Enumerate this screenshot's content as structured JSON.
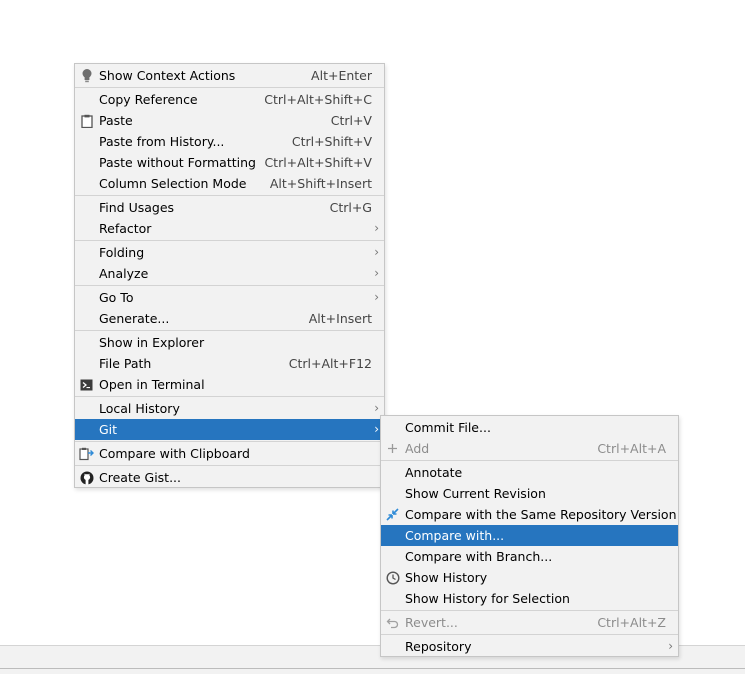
{
  "main_menu": {
    "groups": [
      [
        {
          "label": "Show Context Actions",
          "shortcut": "Alt+Enter",
          "icon": "bulb-icon"
        }
      ],
      [
        {
          "label": "Copy Reference",
          "shortcut": "Ctrl+Alt+Shift+C"
        },
        {
          "label": "Paste",
          "shortcut": "Ctrl+V",
          "icon": "clipboard-icon"
        },
        {
          "label": "Paste from History...",
          "shortcut": "Ctrl+Shift+V"
        },
        {
          "label": "Paste without Formatting",
          "shortcut": "Ctrl+Alt+Shift+V"
        },
        {
          "label": "Column Selection Mode",
          "shortcut": "Alt+Shift+Insert"
        }
      ],
      [
        {
          "label": "Find Usages",
          "shortcut": "Ctrl+G"
        },
        {
          "label": "Refactor",
          "submenu": true
        }
      ],
      [
        {
          "label": "Folding",
          "submenu": true
        },
        {
          "label": "Analyze",
          "submenu": true
        }
      ],
      [
        {
          "label": "Go To",
          "submenu": true
        },
        {
          "label": "Generate...",
          "shortcut": "Alt+Insert"
        }
      ],
      [
        {
          "label": "Show in Explorer"
        },
        {
          "label": "File Path",
          "shortcut": "Ctrl+Alt+F12"
        },
        {
          "label": "Open in Terminal",
          "icon": "terminal-icon"
        }
      ],
      [
        {
          "label": "Local History",
          "submenu": true
        },
        {
          "label": "Git",
          "submenu": true,
          "selected": true
        }
      ],
      [
        {
          "label": "Compare with Clipboard",
          "icon": "compare-clipboard-icon"
        }
      ],
      [
        {
          "label": "Create Gist...",
          "icon": "github-icon"
        }
      ]
    ]
  },
  "git_menu": {
    "groups": [
      [
        {
          "label": "Commit File..."
        },
        {
          "label": "Add",
          "shortcut": "Ctrl+Alt+A",
          "icon": "plus-icon",
          "disabled": true
        }
      ],
      [
        {
          "label": "Annotate"
        },
        {
          "label": "Show Current Revision"
        },
        {
          "label": "Compare with the Same Repository Version",
          "icon": "diff-icon"
        },
        {
          "label": "Compare with...",
          "selected": true
        },
        {
          "label": "Compare with Branch..."
        },
        {
          "label": "Show History",
          "icon": "clock-icon"
        },
        {
          "label": "Show History for Selection"
        }
      ],
      [
        {
          "label": "Revert...",
          "shortcut": "Ctrl+Alt+Z",
          "icon": "revert-icon",
          "disabled": true
        }
      ],
      [
        {
          "label": "Repository",
          "submenu": true
        }
      ]
    ]
  },
  "submenu_arrow": "›",
  "colors": {
    "selection": "#2675bf",
    "menu_bg": "#f2f2f2"
  }
}
